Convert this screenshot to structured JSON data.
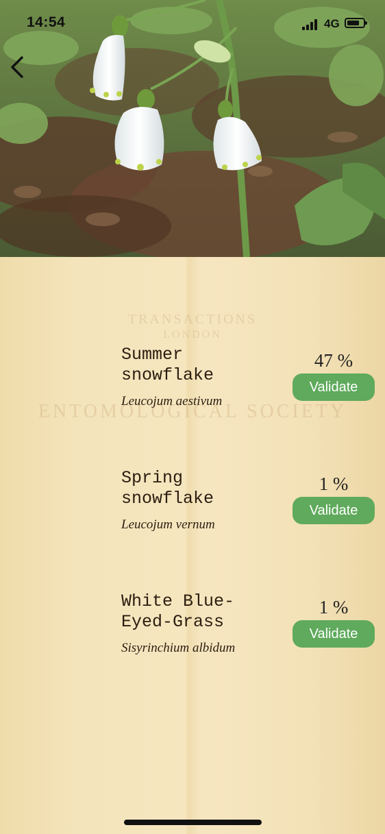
{
  "status_bar": {
    "time": "14:54",
    "network": "4G"
  },
  "photo": {
    "subject": "white bell-shaped flowers"
  },
  "watermark": {
    "lines": [
      "TRANSACTIONS",
      "LONDON",
      "ENTOMOLOGICAL SOCIETY"
    ]
  },
  "results": [
    {
      "common_name": "Summer\nsnowflake",
      "scientific_name": "Leucojum aestivum",
      "confidence": "47 %",
      "validate_label": "Validate"
    },
    {
      "common_name": "Spring\nsnowflake",
      "scientific_name": "Leucojum vernum",
      "confidence": "1 %",
      "validate_label": "Validate"
    },
    {
      "common_name": "White Blue-\nEyed-Grass",
      "scientific_name": "Sisyrinchium albidum",
      "confidence": "1 %",
      "validate_label": "Validate"
    }
  ],
  "colors": {
    "accent": "#5faa5c",
    "paper": "#f3e2b8",
    "text": "#2b1d10"
  },
  "icons": {
    "back": "chevron-left-icon"
  }
}
